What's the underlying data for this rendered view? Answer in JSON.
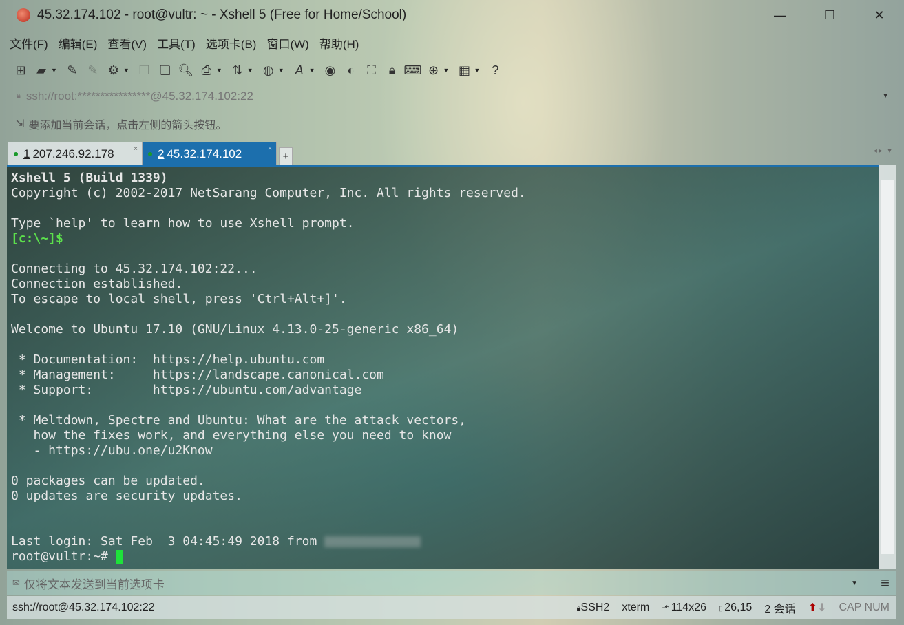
{
  "window": {
    "title": "45.32.174.102 - root@vultr: ~ - Xshell 5 (Free for Home/School)",
    "minimize": "—",
    "maximize": "☐",
    "close": "✕"
  },
  "menu": [
    "文件(F)",
    "编辑(E)",
    "查看(V)",
    "工具(T)",
    "选项卡(B)",
    "窗口(W)",
    "帮助(H)"
  ],
  "address": {
    "value": "ssh://root:****************@45.32.174.102:22"
  },
  "hint": "要添加当前会话，点击左侧的箭头按钮。",
  "tabs": [
    {
      "num": "1",
      "label": "207.246.92.178",
      "close": "×"
    },
    {
      "num": "2",
      "label": "45.32.174.102",
      "close": "×"
    }
  ],
  "tab_add": "+",
  "terminal": {
    "lines": [
      {
        "t": "Xshell 5 (Build 1339)",
        "s": "b"
      },
      {
        "t": "Copyright (c) 2002-2017 NetSarang Computer, Inc. All rights reserved."
      },
      {
        "t": ""
      },
      {
        "t": "Type `help' to learn how to use Xshell prompt."
      },
      {
        "t": "[c:\\~]$",
        "s": "g"
      },
      {
        "t": ""
      },
      {
        "t": "Connecting to 45.32.174.102:22..."
      },
      {
        "t": "Connection established."
      },
      {
        "t": "To escape to local shell, press 'Ctrl+Alt+]'."
      },
      {
        "t": ""
      },
      {
        "t": "Welcome to Ubuntu 17.10 (GNU/Linux 4.13.0-25-generic x86_64)"
      },
      {
        "t": ""
      },
      {
        "t": " * Documentation:  https://help.ubuntu.com"
      },
      {
        "t": " * Management:     https://landscape.canonical.com"
      },
      {
        "t": " * Support:        https://ubuntu.com/advantage"
      },
      {
        "t": ""
      },
      {
        "t": " * Meltdown, Spectre and Ubuntu: What are the attack vectors,"
      },
      {
        "t": "   how the fixes work, and everything else you need to know"
      },
      {
        "t": "   - https://ubu.one/u2Know"
      },
      {
        "t": ""
      },
      {
        "t": "0 packages can be updated."
      },
      {
        "t": "0 updates are security updates."
      },
      {
        "t": ""
      },
      {
        "t": ""
      }
    ],
    "last_login": "Last login: Sat Feb  3 04:45:49 2018 from ",
    "prompt": "root@vultr:~# "
  },
  "compose": {
    "placeholder": "仅将文本发送到当前选项卡"
  },
  "status": {
    "path": "ssh://root@45.32.174.102:22",
    "protocol": "SSH2",
    "term": "xterm",
    "size": "114x26",
    "cursor": "26,15",
    "sessions": "2 会话",
    "caps": "CAP NUM"
  }
}
